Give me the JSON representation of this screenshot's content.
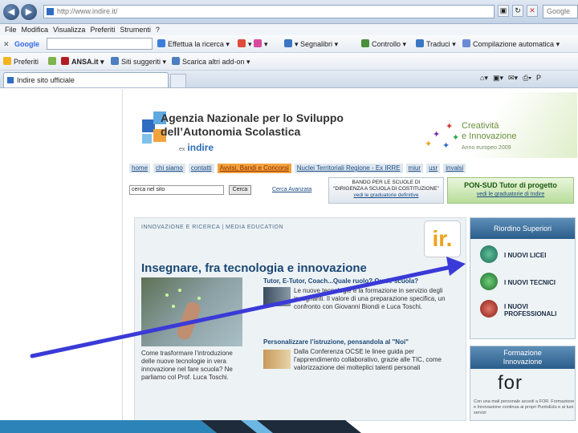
{
  "browser": {
    "address": "http://www.indire.it/",
    "search_placeholder": "Google",
    "menu": [
      "File",
      "Modifica",
      "Visualizza",
      "Preferiti",
      "Strumenti",
      "?"
    ],
    "google_bar": {
      "brand": "Google",
      "items": [
        "Effettua la ricerca",
        "Segnalibri",
        "Controllo",
        "Traduci",
        "Compilazione automatica"
      ]
    },
    "favorites_bar": {
      "items": [
        "Preferiti",
        "ANSA.it",
        "Siti suggeriti",
        "Scarica altri add-on"
      ]
    },
    "tab_title": "Indire sito ufficiale"
  },
  "site": {
    "title": "Agenzia Nazionale per lo Sviluppo dell’Autonomia Scolastica",
    "logo_prefix": "ex",
    "logo": "indire",
    "creativity_line1": "Creatività",
    "creativity_line2": "e Innovazione",
    "creativity_sub": "Anno europeo 2009",
    "nav": [
      "home",
      "chi siamo",
      "contatti",
      "Avvisi, Bandi e Concorsi",
      "Nuclei Territoriali Regione - Ex IRRE",
      "miur",
      "usr",
      "invalsi"
    ],
    "search_value": "cerca nel sito",
    "search_button": "Cerca",
    "search_advanced": "Cerca Avanzata",
    "bando": [
      "BANDO PER LE SCUOLE DI",
      "“DIRIGENZA A SCUOLA DI COSTITUZIONE”",
      "vedi le graduatorie definitive"
    ],
    "pon": [
      "PON-SUD Tutor di progetto",
      "vedi le graduatorie di Indire"
    ],
    "kicker": "INNOVAZIONE E RICERCA | MEDIA EDUCATION",
    "ir_logo": "ir.",
    "headline": "Insegnare, fra tecnologia e innovazione",
    "caption": "Come trasformare l’introduzione delle nuove tecnologie in vera innovazione nel fare scuola? Ne parliamo col Prof. Luca Toschi.",
    "article1": {
      "title": "Tutor, E-Tutor, Coach...Quale ruolo? Quale scuola?",
      "text": "Le nuove tecnologie e la formazione in servizio degli insegnanti. Il valore di una preparazione specifica, un confronto con Giovanni Biondi e Luca Toschi."
    },
    "article2": {
      "title": "Personalizzare l’istruzione, pensandola al \"Noi\"",
      "text": "Dalla Conferenza OCSE le linee guida per l’apprendimento collaborativo, grazie alle TIC, come valorizzazione dei molteplici talenti personali"
    },
    "riordino": {
      "title": "Riordino Superiori",
      "items": [
        "I NUOVI LICEI",
        "I NUOVI TECNICI",
        "I NUOVI PROFESSIONALI"
      ]
    },
    "formazione": {
      "title_line1": "Formazione",
      "title_line2": "Innovazione",
      "logo": "for",
      "text": "Con una mail personale accedi a FOR. Formazione e Innovazione continua ai propri PuntoEdu e ai tuoi servizi"
    }
  },
  "colors": {
    "arrow": "#3a3ad8",
    "accent_orange": "#f2a23d",
    "headline_blue": "#1b4876"
  }
}
